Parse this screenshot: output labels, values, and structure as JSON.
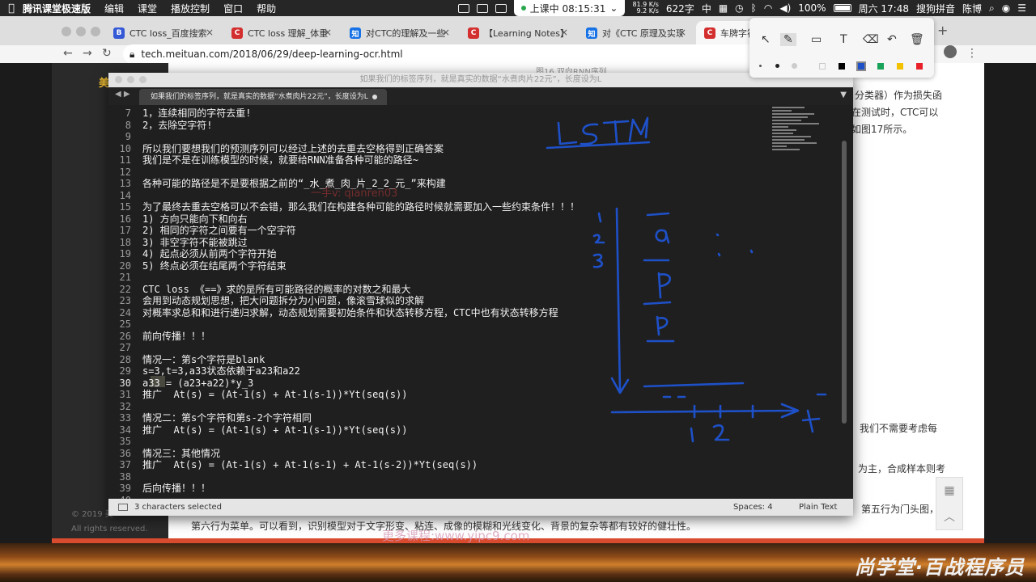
{
  "menubar": {
    "apple": "",
    "app_name": "腾讯课堂极速版",
    "menus": [
      "编辑",
      "课堂",
      "播放控制",
      "窗口",
      "帮助"
    ],
    "class_status": "上课中 08:15:31",
    "net_up": "81.9 K/s",
    "net_down": "9.2 K/s",
    "memory": "622字",
    "input_lang": "中",
    "battery": "100%",
    "datetime": "周六 17:48",
    "ime": "搜狗拼音",
    "user": "陈博"
  },
  "browser": {
    "tabs": [
      {
        "title": "CTC loss_百度搜索",
        "fav": "B",
        "color": "#3458d6"
      },
      {
        "title": "CTC loss 理解_体重",
        "fav": "C",
        "color": "#d32f2f"
      },
      {
        "title": "对CTC的理解及一些",
        "fav": "知",
        "color": "#1772e6"
      },
      {
        "title": "【Learning Notes】",
        "fav": "C",
        "color": "#d32f2f"
      },
      {
        "title": "对《CTC 原理及实现",
        "fav": "知",
        "color": "#1772e6"
      },
      {
        "title": "车牌字符识别",
        "fav": "C",
        "color": "#d32f2f"
      }
    ],
    "url": "tech.meituan.com/2018/06/29/deep-learning-ocr.html"
  },
  "page": {
    "fig_caption": "图16 双向RNN序列",
    "right_snippets": [
      "分类器）作为损失函",
      "在测试时，CTC可以",
      "如图17所示。",
      "我们不需要考虑每",
      "为主，合成样本则考",
      "第五行为门头图，"
    ],
    "bottom_text": "第六行为菜单。可以看到，识别模型对于文字形变、粘连、成像的模糊和光线变化、背景的复杂等都有较好的健壮性。",
    "left_logo": "美",
    "copyright": "© 2019 美",
    "rights": "All rights reserved.",
    "ad_watermark": "更多课程:www.yipc9.com",
    "brand_watermark": "尚学堂·百战程序员"
  },
  "sublime": {
    "title": "如果我们的标签序列，就是真实的数据“水煮肉片22元”，长度设为L",
    "tab_title": "如果我们的标签序列，就是真实的数据“水煮肉片22元”，长度设为L",
    "watermark": "一手v: qianren03",
    "status_left": "3 characters selected",
    "status_spaces": "Spaces: 4",
    "status_syntax": "Plain Text",
    "lines": [
      {
        "n": "7",
        "t": "1，连续相同的字符去重!"
      },
      {
        "n": "8",
        "t": "2，去除空字符!"
      },
      {
        "n": "9",
        "t": ""
      },
      {
        "n": "10",
        "t": "所以我们要想我们的预测序列可以经过上述的去重去空格得到正确答案"
      },
      {
        "n": "11",
        "t": "我们是不是在训练模型的时候，就要给RNN准备各种可能的路径~"
      },
      {
        "n": "12",
        "t": ""
      },
      {
        "n": "13",
        "t": "各种可能的路径是不是要根据之前的“_水_煮_肉_片_2_2_元_”来构建"
      },
      {
        "n": "14",
        "t": ""
      },
      {
        "n": "15",
        "t": "为了最终去重去空格可以不会错，那么我们在构建各种可能的路径时候就需要加入一些约束条件！！！"
      },
      {
        "n": "16",
        "t": "1) 方向只能向下和向右"
      },
      {
        "n": "17",
        "t": "2) 相同的字符之间要有一个空字符"
      },
      {
        "n": "18",
        "t": "3) 非空字符不能被跳过"
      },
      {
        "n": "19",
        "t": "4) 起点必须从前两个字符开始"
      },
      {
        "n": "20",
        "t": "5) 终点必须在结尾两个字符结束"
      },
      {
        "n": "21",
        "t": ""
      },
      {
        "n": "22",
        "t": "CTC loss 《==》求的是所有可能路径的概率的对数之和最大"
      },
      {
        "n": "23",
        "t": "会用到动态规划思想，把大问题拆分为小问题，像滚雪球似的求解"
      },
      {
        "n": "24",
        "t": "对概率求总和和进行递归求解，动态规划需要初始条件和状态转移方程，CTC中也有状态转移方程"
      },
      {
        "n": "25",
        "t": ""
      },
      {
        "n": "26",
        "t": "前向传播！！！"
      },
      {
        "n": "27",
        "t": ""
      },
      {
        "n": "28",
        "t": "情况一：第s个字符是blank"
      },
      {
        "n": "29",
        "t": "s=3,t=3,a33状态依赖于a23和a22"
      },
      {
        "n": "30",
        "t": "a33 = (a23+a22)*y_3"
      },
      {
        "n": "31",
        "t": "推广  At(s) = (At-1(s) + At-1(s-1))*Yt(seq(s))"
      },
      {
        "n": "32",
        "t": ""
      },
      {
        "n": "33",
        "t": "情况二：第s个字符和第s-2个字符相同"
      },
      {
        "n": "34",
        "t": "推广  At(s) = (At-1(s) + At-1(s-1))*Yt(seq(s))"
      },
      {
        "n": "35",
        "t": ""
      },
      {
        "n": "36",
        "t": "情况三：其他情况"
      },
      {
        "n": "37",
        "t": "推广  At(s) = (At-1(s) + At-1(s-1) + At-1(s-2))*Yt(seq(s))"
      },
      {
        "n": "38",
        "t": ""
      },
      {
        "n": "39",
        "t": "后向传播！！！"
      },
      {
        "n": "40",
        "t": ""
      }
    ]
  },
  "handwriting": {
    "title_word": "LSTM",
    "row_labels": [
      "1",
      "2",
      "3"
    ],
    "column_letters": [
      "a",
      "p",
      "p"
    ],
    "axis_ticks": [
      "1",
      "2"
    ],
    "axis_t": "t",
    "ink_color": "#1e50c8"
  },
  "annotation_toolbar": {
    "colors": [
      "#ffffff",
      "#000000",
      "#1e50c8",
      "#19a35a",
      "#f2c200",
      "#e8202a"
    ]
  }
}
